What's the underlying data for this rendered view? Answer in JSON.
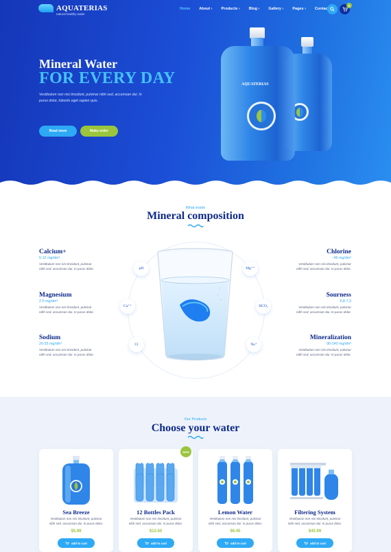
{
  "brand": {
    "name": "AQUATERIAS",
    "tagline": "natural healthy water"
  },
  "nav": {
    "items": [
      {
        "label": "Home",
        "active": true
      },
      {
        "label": "About ›"
      },
      {
        "label": "Products ›"
      },
      {
        "label": "Blog ›"
      },
      {
        "label": "Gallery ›"
      },
      {
        "label": "Pages ›"
      },
      {
        "label": "Contacts"
      }
    ],
    "cart_count": "0"
  },
  "hero": {
    "title_line1": "Mineral Water",
    "title_line2": "FOR EVERY DAY",
    "description": "Vestibulum non nisi tincidunt, pulvinar nibh sed, accumsan dui. In purus dolor, lobortis eget sapien quis.",
    "read_more": "Read more",
    "make_order": "Make order",
    "bottle_brand": "AQUATERIAS"
  },
  "composition": {
    "eyebrow": "What inside",
    "title": "Mineral composition",
    "minerals": [
      {
        "name": "Calcium+",
        "amount": "5-12 mg/dm³",
        "desc": "Vestibulum non nisi tincidunt, pulvinar nibh sed, accumsan dui. In purus dolor."
      },
      {
        "name": "Magnesium",
        "amount": "2-5 mg/dm³",
        "desc": "Vestibulum non nisi tincidunt, pulvinar nibh sed, accumsan dui. In purus dolor."
      },
      {
        "name": "Sodium",
        "amount": "20-25 mg/dm³",
        "desc": "Vestibulum non nisi tincidunt, pulvinar nibh sed, accumsan dui. In purus dolor."
      },
      {
        "name": "Chlorine",
        "amount": "-46 mg/dm³",
        "desc": "Vestibulum non nisi tincidunt, pulvinar nibh sed, accumsan dui. In purus dolor."
      },
      {
        "name": "Sourness",
        "amount": "6,8-7,3",
        "desc": "Vestibulum non nisi tincidunt, pulvinar nibh sed, accumsan dui. In purus dolor."
      },
      {
        "name": "Mineralization",
        "amount": "90-140 mg/dm³",
        "desc": "Vestibulum non nisi tincidunt, pulvinar nibh sed, accumsan dui. In purus dolor."
      }
    ],
    "elements": [
      "pH",
      "Mg⁺⁺",
      "Ca⁺⁺",
      "HCO₃",
      "Cl",
      "Na⁺"
    ]
  },
  "products": {
    "eyebrow": "Our Products",
    "title": "Choose your water",
    "add_to_cart": "add to cart",
    "new_label": "NEW",
    "items": [
      {
        "name": "Sea Breeze",
        "desc": "Vestibulum non nisi tincidunt, pulvinar nibh sed, accumsan dui. In purus dolor.",
        "price": "$5.99"
      },
      {
        "name": "12 Bottles Pack",
        "desc": "Vestibulum non nisi tincidunt, pulvinar nibh sed, accumsan dui. In purus dolor.",
        "price": "$12.50",
        "is_new": true
      },
      {
        "name": "Lemon Water",
        "desc": "Vestibulum non nisi tincidunt, pulvinar nibh sed, accumsan dui. In purus dolor.",
        "price": "$6.45"
      },
      {
        "name": "Filtering System",
        "desc": "Vestibulum non nisi tincidunt, pulvinar nibh sed, accumsan dui. In purus dolor.",
        "price": "$45.99"
      }
    ]
  },
  "colors": {
    "accent": "#2ea9f5",
    "green": "#9bc53d",
    "navy": "#0e2a8a"
  }
}
